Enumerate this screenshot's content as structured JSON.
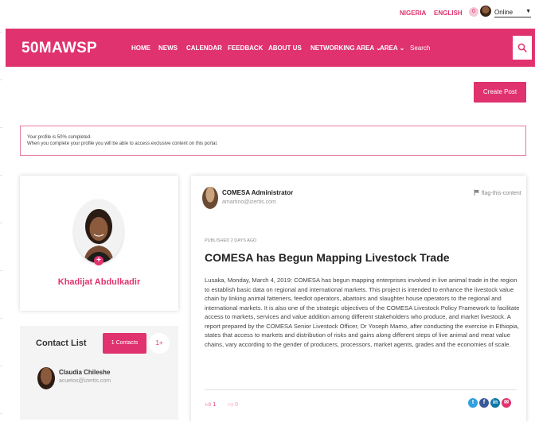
{
  "topbar": {
    "lang_nigeria": "NIGERIA",
    "lang_english": "ENGLISH",
    "notifications": "0",
    "status": "Online",
    "status_caret": "▼"
  },
  "navbar": {
    "brand": "50MAWSP",
    "items": [
      "HOME",
      "NEWS",
      "CALENDAR",
      "FEEDBACK",
      "ABOUT US",
      "NETWORKING AREA ⌄",
      "AREA ⌄"
    ],
    "search_placeholder": "Search"
  },
  "create_post_label": "Create Post",
  "notice": {
    "line1": "Your profile is 50% completed.",
    "line2": "When you complete your profile you will be able to access exclusive content on this portal."
  },
  "profile": {
    "name": "Khadijat Abdulkadir",
    "plus": "+"
  },
  "contacts": {
    "title": "Contact List",
    "button_label": "1 Contacts",
    "more": "1+",
    "items": [
      {
        "name": "Claudia Chileshe",
        "email": "acuetos@izertis.com"
      }
    ]
  },
  "post": {
    "author": "COMESA Administrator",
    "email": "amartino@izertis.com",
    "flag_label": "flag-this-content",
    "published": "PUBLISHED 2 DAYS AGO",
    "title": "COMESA has Begun Mapping Livestock Trade",
    "body": "Lusaka, Monday, March 4, 2019: COMESA has begun mapping enterprises involved in live animal trade in the region to establish basic data on regional and international markets. This project is intended to enhance the livestock value chain by linking animal fatteners, feedlot operators, abattoirs and slaughter house operators to the regional and international markets. It is also one of the strategic objectives of the COMESA Livestock Policy Framework to facilitate access to markets, services and value addition among different stakeholders who produce, and market livestock. A report prepared by the COMESA Senior Livestock Officer, Dr Yoseph Mamo, after conducting the exercise in Ethiopia, states that access to markets and distribution of risks and gains along different steps of live animal and meat value chains, vary according to the gender of producers, processors, market agents, grades and the economies of scale.",
    "likes": "1",
    "dislikes": "0",
    "share_icons": [
      "twitter-icon",
      "facebook-icon",
      "linkedin-icon",
      "mail-icon"
    ]
  },
  "colors": {
    "brand": "#e0326e",
    "twitter": "#2f9fe0",
    "facebook": "#3b5998",
    "linkedin": "#0e76a8"
  }
}
